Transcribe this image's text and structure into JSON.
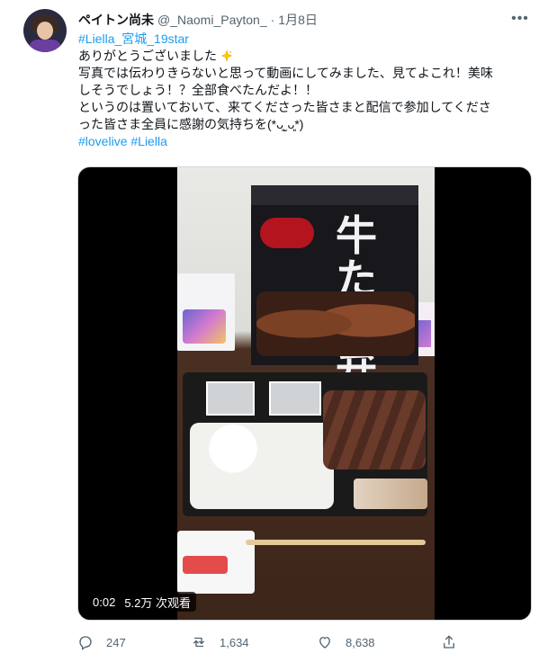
{
  "header": {
    "display_name": "ペイトン尚未",
    "handle": "@_Naomi_Payton_",
    "dot": "·",
    "time": "1月8日"
  },
  "body": {
    "hashtag_top": "#Liella_宮城_19star",
    "line1": "ありがとうございました",
    "line2": "写真では伝わりきらないと思って動画にしてみました、見てよこれ！美味",
    "line3": "しそうでしょう！？全部食べたんだよ！！",
    "line4": "というのは置いておいて、来てくださった皆さまと配信で参加してくださ",
    "line5": "った皆さま全員に感謝の気持ちを(*ᴗ͈ˬᴗ͈*)",
    "hashtag_bottom1": "#lovelive",
    "hashtag_bottom2": "#Liella"
  },
  "media": {
    "time": "0:02",
    "views": "5.2万 次观看",
    "box_text": "牛たん弁当"
  },
  "actions": {
    "reply_count": "247",
    "retweet_count": "1,634",
    "like_count": "8,638"
  },
  "icons": [
    "avatar",
    "more-icon",
    "sparkle-icon",
    "reply-icon",
    "retweet-icon",
    "like-icon",
    "share-icon"
  ],
  "colors": {
    "link": "#1d9bf0",
    "muted": "#536471",
    "text": "#0f1419"
  }
}
